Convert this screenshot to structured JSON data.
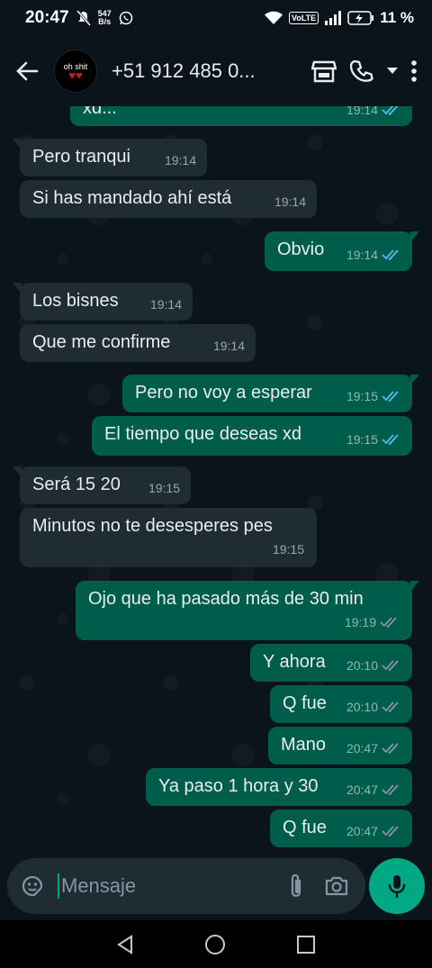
{
  "status_bar": {
    "time": "20:47",
    "speed_top": "547",
    "speed_bottom": "B/s",
    "volte": "VoLTE",
    "battery": "11 %"
  },
  "header": {
    "avatar_text": "oh shit",
    "avatar_hearts": "♥♥",
    "contact_name": "+51 912 485 0..."
  },
  "messages": [
    {
      "dir": "out",
      "text": "xd...",
      "time": "19:14",
      "ticks": "read"
    },
    {
      "dir": "in",
      "text": "Pero tranqui",
      "time": "19:14"
    },
    {
      "dir": "in",
      "text": "Si has mandado ahí está",
      "time": "19:14"
    },
    {
      "dir": "out",
      "text": "Obvio",
      "time": "19:14",
      "ticks": "read"
    },
    {
      "dir": "in",
      "text": "Los bisnes",
      "time": "19:14"
    },
    {
      "dir": "in",
      "text": "Que me confirme",
      "time": "19:14"
    },
    {
      "dir": "out",
      "text": "Pero no voy a esperar",
      "time": "19:15",
      "ticks": "read"
    },
    {
      "dir": "out",
      "text": "El tiempo que deseas xd",
      "time": "19:15",
      "ticks": "read"
    },
    {
      "dir": "in",
      "text": "Será 15 20",
      "time": "19:15"
    },
    {
      "dir": "in",
      "text": "Minutos no te desesperes pes",
      "time": "19:15"
    },
    {
      "dir": "out",
      "text": "Ojo que ha pasado más de 30 min",
      "time": "19:19",
      "ticks": "delivered"
    },
    {
      "dir": "out",
      "text": "Y ahora",
      "time": "20:10",
      "ticks": "delivered"
    },
    {
      "dir": "out",
      "text": "Q fue",
      "time": "20:10",
      "ticks": "delivered"
    },
    {
      "dir": "out",
      "text": "Mano",
      "time": "20:47",
      "ticks": "delivered"
    },
    {
      "dir": "out",
      "text": "Ya paso 1 hora y 30",
      "time": "20:47",
      "ticks": "delivered"
    },
    {
      "dir": "out",
      "text": "Q fue",
      "time": "20:47",
      "ticks": "delivered"
    }
  ],
  "input": {
    "placeholder": "Mensaje"
  },
  "colors": {
    "incoming_bubble": "#202c33",
    "outgoing_bubble": "#005c4b",
    "read_tick": "#53bdeb",
    "delivered_tick": "#8696a0",
    "accent": "#00a884"
  }
}
